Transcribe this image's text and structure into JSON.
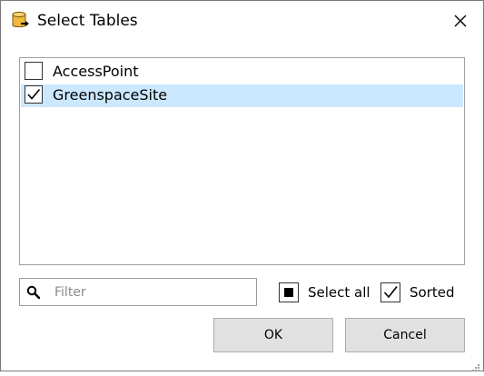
{
  "window": {
    "title": "Select Tables",
    "icon": "database-export-icon"
  },
  "table_list": {
    "items": [
      {
        "label": "AccessPoint",
        "checked": false,
        "selected": false
      },
      {
        "label": "GreenspaceSite",
        "checked": true,
        "selected": true
      }
    ]
  },
  "filter": {
    "value": "",
    "placeholder": "Filter",
    "icon": "search-icon"
  },
  "options": {
    "select_all_label": "Select all",
    "select_all_state": "indeterminate",
    "sorted_label": "Sorted",
    "sorted_checked": true
  },
  "buttons": {
    "ok_label": "OK",
    "cancel_label": "Cancel"
  },
  "colors": {
    "selection": "#cce8ff",
    "button_face": "#e1e1e1",
    "icon_accent": "#f0b840"
  }
}
